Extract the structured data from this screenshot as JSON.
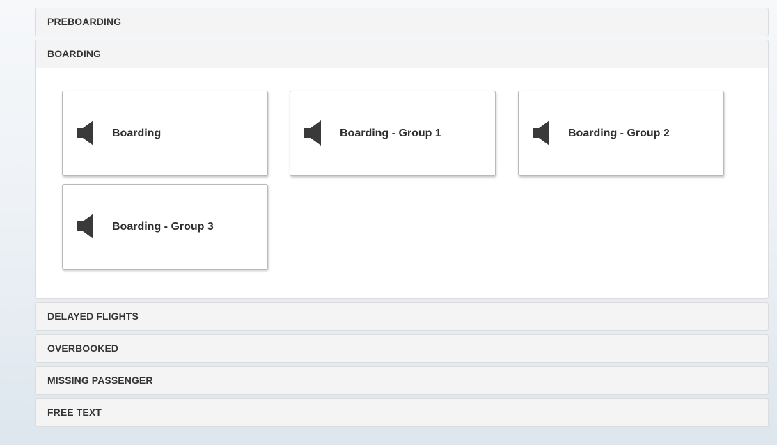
{
  "accordion": {
    "sections": [
      {
        "label": "PREBOARDING"
      },
      {
        "label": "BOARDING"
      },
      {
        "label": "DELAYED FLIGHTS"
      },
      {
        "label": "OVERBOOKED"
      },
      {
        "label": "MISSING PASSENGER"
      },
      {
        "label": "FREE TEXT"
      }
    ]
  },
  "boarding": {
    "tiles": [
      {
        "label": "Boarding",
        "icon": "speaker-icon"
      },
      {
        "label": "Boarding - Group 1",
        "icon": "speaker-icon"
      },
      {
        "label": "Boarding - Group 2",
        "icon": "speaker-icon"
      },
      {
        "label": "Boarding - Group 3",
        "icon": "speaker-icon"
      }
    ]
  },
  "colors": {
    "header_bg": "#f4f4f4",
    "panel_bg": "#ffffff",
    "text": "#333333",
    "icon": "#3a3a3a"
  }
}
